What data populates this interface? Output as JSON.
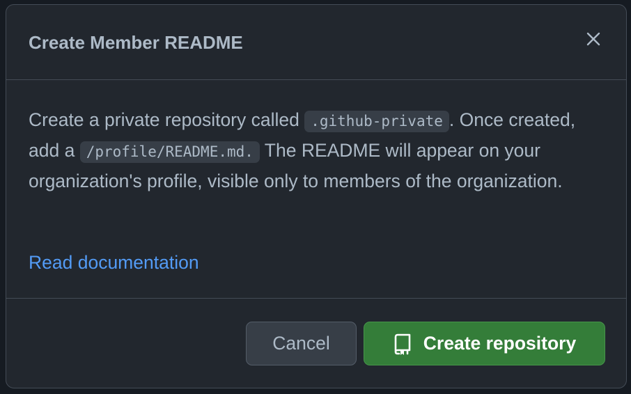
{
  "dialog": {
    "title": "Create Member README",
    "close_icon": "x-icon",
    "description": {
      "part1": "Create a private repository called ",
      "code1": ".github-private",
      "part2": ". Once created, add a ",
      "code2": "/profile/README.md.",
      "part3": " The README will appear on your organization's profile, visible only to members of the organization."
    },
    "doc_link": "Read documentation",
    "buttons": {
      "cancel_label": "Cancel",
      "create_label": "Create repository",
      "create_icon": "repo-icon"
    }
  },
  "colors": {
    "dialog_bg": "#22272e",
    "border": "#444c56",
    "text": "#adbac7",
    "link": "#539bf5",
    "primary_button": "#347d39",
    "secondary_button": "#373e47"
  }
}
